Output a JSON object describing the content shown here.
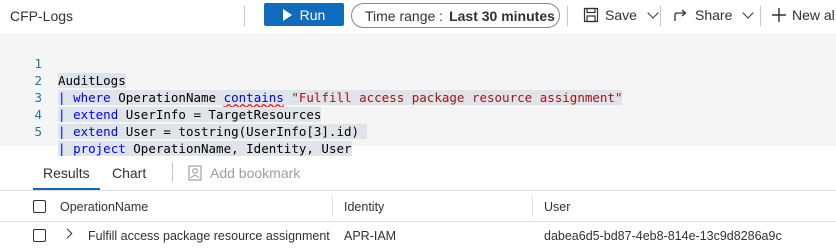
{
  "toolbar": {
    "title": "CFP-Logs",
    "run_label": "Run",
    "time_range_label": "Time range :",
    "time_range_value": "Last 30 minutes",
    "save_label": "Save",
    "share_label": "Share",
    "new_label": "New al"
  },
  "editor": {
    "lines": [
      {
        "num": "1",
        "text": "AuditLogs"
      },
      {
        "num": "2",
        "text": "| where OperationName contains \"Fulfill access package resource assignment\""
      },
      {
        "num": "3",
        "text": "| extend UserInfo = TargetResources"
      },
      {
        "num": "4",
        "text": "| extend User = tostring(UserInfo[3].id)"
      },
      {
        "num": "5",
        "text": "| project OperationName, Identity, User"
      }
    ]
  },
  "results": {
    "tabs": [
      "Results",
      "Chart"
    ],
    "bookmark_label": "Add bookmark",
    "columns": [
      "OperationName",
      "Identity",
      "User"
    ],
    "rows": [
      [
        "Fulfill access package resource assignment",
        "APR-IAM",
        "dabea6d5-bd87-4eb8-814e-13c9d8286a9c"
      ]
    ]
  },
  "colors": {
    "accent": "#0f6cbd",
    "keyword": "#0000ff",
    "string": "#a31515"
  }
}
